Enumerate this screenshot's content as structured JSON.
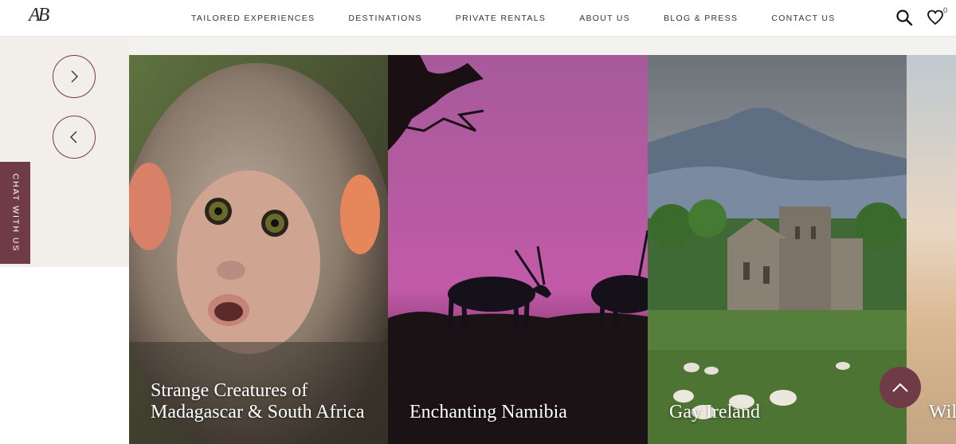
{
  "header": {
    "logo": "AB",
    "nav": [
      "TAILORED EXPERIENCES",
      "DESTINATIONS",
      "PRIVATE RENTALS",
      "ABOUT US",
      "BLOG & PRESS",
      "CONTACT US"
    ],
    "wishlist_count": "0"
  },
  "chat": {
    "label": "CHAT WITH US"
  },
  "cards": [
    {
      "title": "Strange Creatures of Madagascar & South Africa"
    },
    {
      "title": "Enchanting Namibia"
    },
    {
      "title": "Gay Ireland"
    },
    {
      "title": "Wil Ma"
    }
  ],
  "colors": {
    "accent": "#6f3b46",
    "namibia_sky": "#b4589f"
  }
}
